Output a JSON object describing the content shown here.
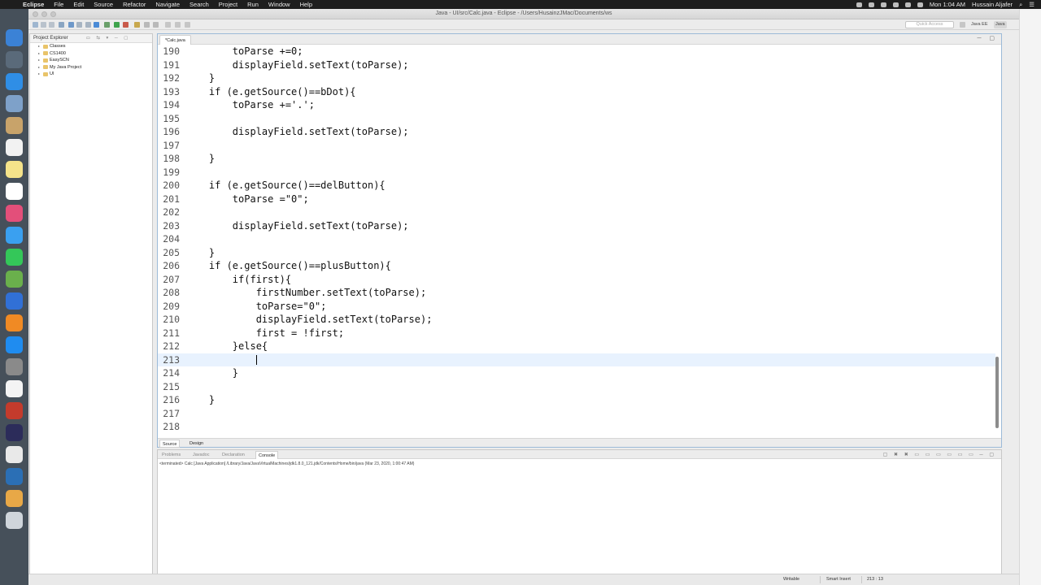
{
  "menubar": {
    "app": "Eclipse",
    "items": [
      "File",
      "Edit",
      "Source",
      "Refactor",
      "Navigate",
      "Search",
      "Project",
      "Run",
      "Window",
      "Help"
    ],
    "clock": "Mon 1:04 AM",
    "user": "Hussain Aljafer"
  },
  "window": {
    "title": "Java - UI/src/Calc.java - Eclipse - /Users/HusainzJMac/Documents/ws",
    "quick_access_placeholder": "Quick Access",
    "perspectives": [
      "Java EE",
      "Java"
    ]
  },
  "explorer": {
    "title": "Project Explorer",
    "items": [
      "Classes",
      "CS1400",
      "EasySCN",
      "My Java Project",
      "UI"
    ]
  },
  "editor": {
    "tab": "*Calc.java",
    "lines": [
      {
        "n": "190",
        "code": "        toParse +=0;"
      },
      {
        "n": "191",
        "code": "        displayField.setText(toParse);"
      },
      {
        "n": "192",
        "code": "    }"
      },
      {
        "n": "193",
        "code": "    if (e.getSource()==bDot){"
      },
      {
        "n": "194",
        "code": "        toParse +='.';"
      },
      {
        "n": "195",
        "code": ""
      },
      {
        "n": "196",
        "code": "        displayField.setText(toParse);"
      },
      {
        "n": "197",
        "code": ""
      },
      {
        "n": "198",
        "code": "    }"
      },
      {
        "n": "199",
        "code": ""
      },
      {
        "n": "200",
        "code": "    if (e.getSource()==delButton){"
      },
      {
        "n": "201",
        "code": "        toParse =\"0\";"
      },
      {
        "n": "202",
        "code": ""
      },
      {
        "n": "203",
        "code": "        displayField.setText(toParse);"
      },
      {
        "n": "204",
        "code": ""
      },
      {
        "n": "205",
        "code": "    }"
      },
      {
        "n": "206",
        "code": "    if (e.getSource()==plusButton){"
      },
      {
        "n": "207",
        "code": "        if(first){"
      },
      {
        "n": "208",
        "code": "            firstNumber.setText(toParse);"
      },
      {
        "n": "209",
        "code": "            toParse=\"0\";"
      },
      {
        "n": "210",
        "code": "            displayField.setText(toParse);"
      },
      {
        "n": "211",
        "code": "            first = !first;"
      },
      {
        "n": "212",
        "code": "        }else{"
      },
      {
        "n": "213",
        "code": "            "
      },
      {
        "n": "214",
        "code": "        }"
      },
      {
        "n": "215",
        "code": ""
      },
      {
        "n": "216",
        "code": "    }"
      },
      {
        "n": "217",
        "code": ""
      },
      {
        "n": "218",
        "code": ""
      }
    ],
    "current_line": "213",
    "bottom_tabs": [
      "Source",
      "Design"
    ]
  },
  "console": {
    "tabs": [
      "Problems",
      "Javadoc",
      "Declaration",
      "Console"
    ],
    "active_tab": "Console",
    "terminated": "<terminated> Calc [Java Application] /Library/Java/JavaVirtualMachines/jdk1.8.0_121.jdk/Contents/Home/bin/java (Mar 23, 2020, 1:00:47 AM)"
  },
  "status": {
    "writable": "Writable",
    "insert_mode": "Smart Insert",
    "position": "213 : 13"
  },
  "colors": {
    "menubar": "#1e1e1e",
    "dock": "#46505a",
    "current_line": "#e8f2fe",
    "editor_border": "#9cbad8"
  }
}
